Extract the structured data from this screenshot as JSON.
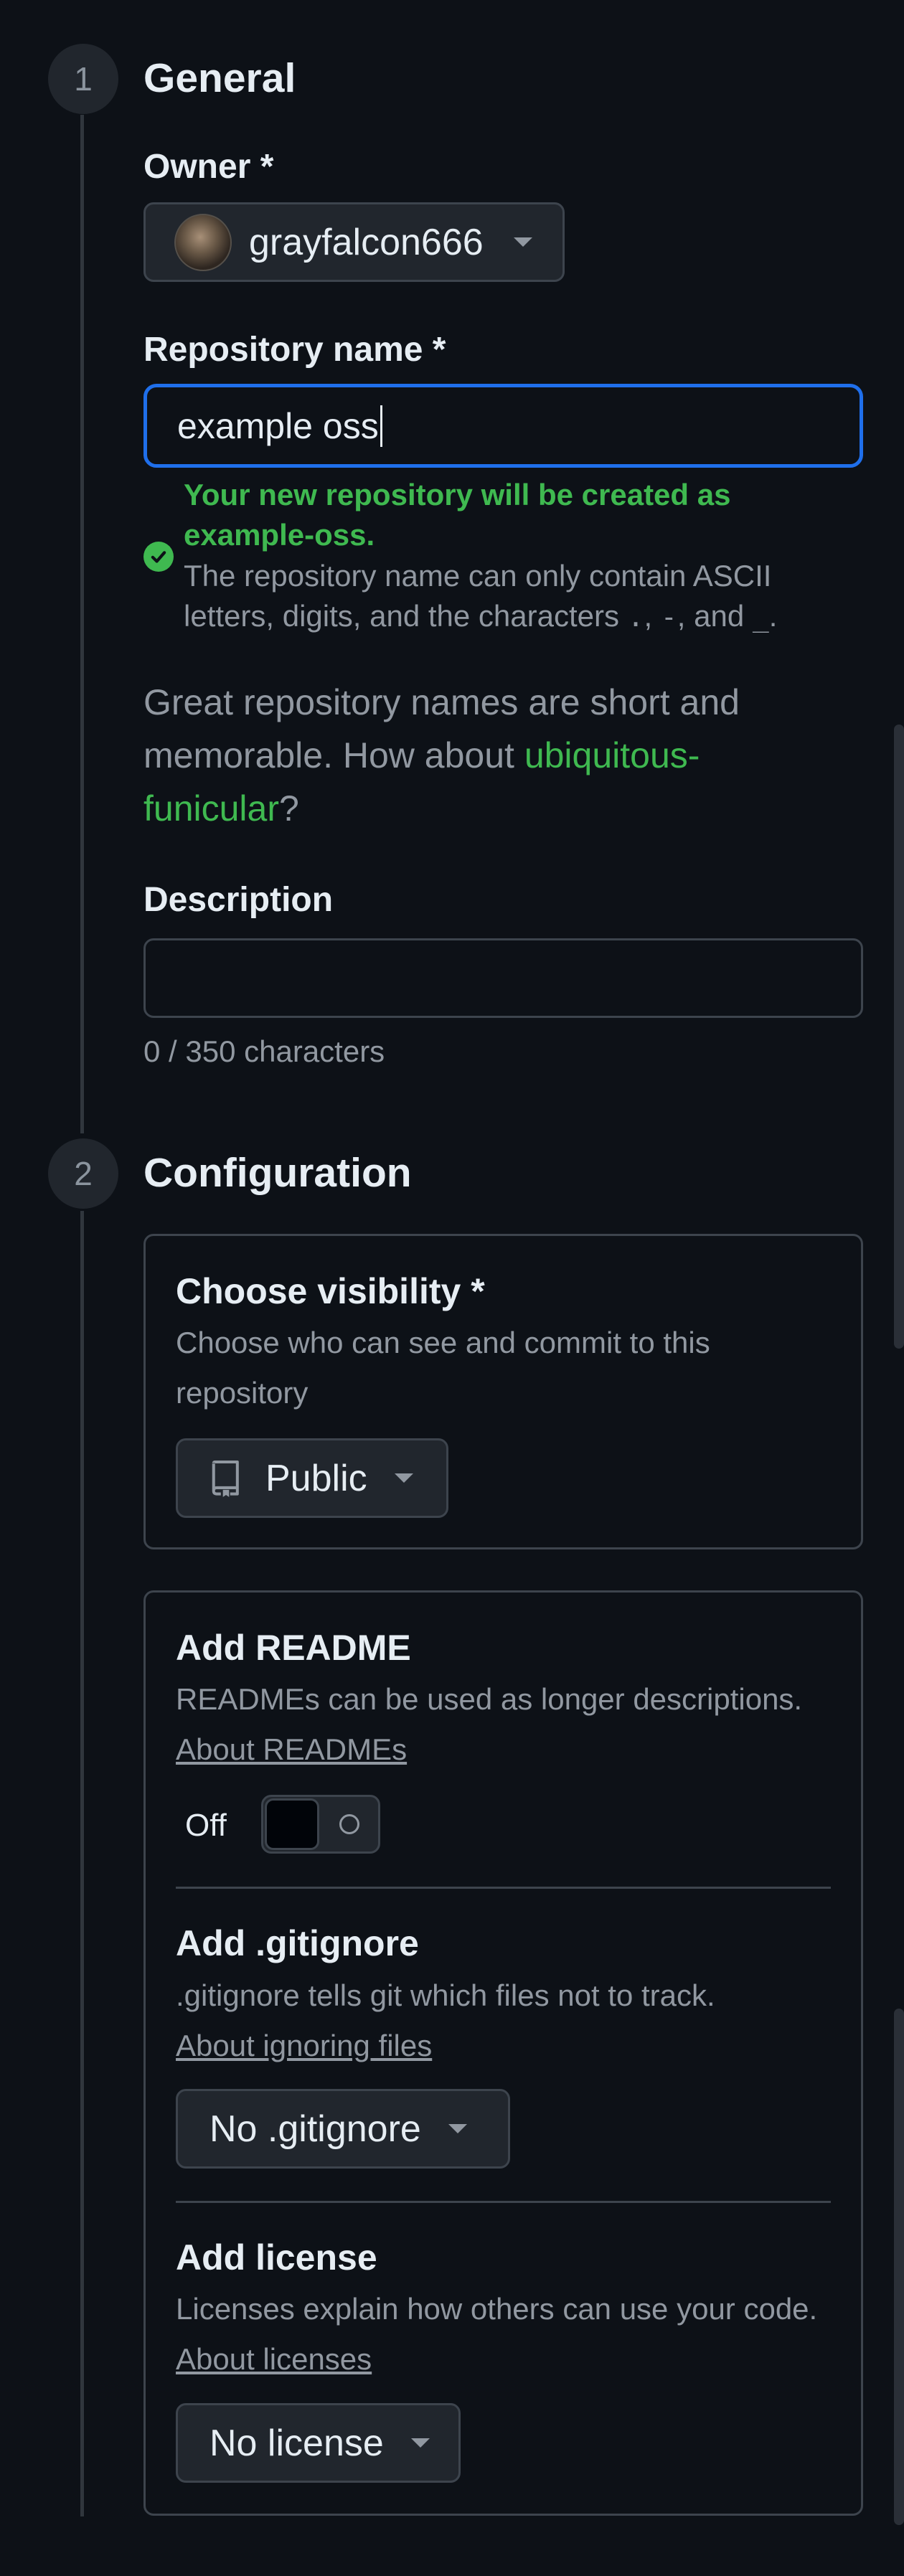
{
  "general": {
    "step_number": "1",
    "title": "General",
    "owner_label": "Owner *",
    "owner_value": "grayfalcon666",
    "repo_name_label": "Repository name *",
    "repo_name_value": "example oss",
    "validation_success": "Your new repository will be created as example-oss.",
    "validation_hint_prefix": "The repository name can only contain ASCII letters, digits, and the characters ",
    "validation_hint_chars": ".",
    "validation_hint_sep1": ", ",
    "validation_hint_char2": "-",
    "validation_hint_sep2": ", and ",
    "validation_hint_char3": "_",
    "validation_hint_end": ".",
    "suggestion_prefix": "Great repository names are short and memorable. How about ",
    "suggestion_name": "ubiquitous-funicular",
    "suggestion_suffix": "?",
    "description_label": "Description",
    "description_value": "",
    "char_count": "0 / 350 characters"
  },
  "configuration": {
    "step_number": "2",
    "title": "Configuration",
    "visibility": {
      "title": "Choose visibility *",
      "description": "Choose who can see and commit to this repository",
      "selected": "Public"
    },
    "readme": {
      "title": "Add README",
      "description": "READMEs can be used as longer descriptions.",
      "link": "About READMEs",
      "toggle_state": "Off"
    },
    "gitignore": {
      "title": "Add .gitignore",
      "description": ".gitignore tells git which files not to track.",
      "link": "About ignoring files",
      "selected": "No .gitignore"
    },
    "license": {
      "title": "Add license",
      "description_prefix": "Licenses explain how others can use your code. ",
      "link": "About licenses",
      "selected": "No license"
    }
  },
  "colors": {
    "background": "#0d1117",
    "focus_border": "#1f6feb",
    "success": "#3fb950",
    "muted": "#9198a1"
  }
}
